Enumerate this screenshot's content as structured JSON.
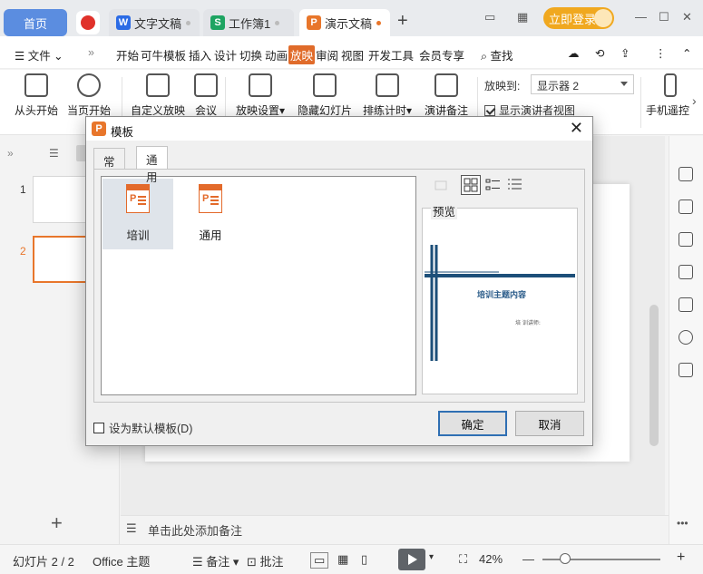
{
  "tabs": {
    "home": "首页",
    "doc": "文字文稿",
    "sheet": "工作簿1",
    "ppt": "演示文稿",
    "login": "立即登录"
  },
  "menu": [
    "开始",
    "可牛模板",
    "插入",
    "设计",
    "切换",
    "动画",
    "放映",
    "审阅",
    "视图",
    "开发工具",
    "会员专享"
  ],
  "menu_active": "放映",
  "file_label": "文件",
  "search_label": "查找",
  "ribbon": {
    "from_start": "从头开始",
    "from_current": "当页开始",
    "custom_show": "自定义放映",
    "meeting": "会议",
    "show_settings": "放映设置",
    "hide_slide": "隐藏幻灯片",
    "rehearse": "排练计时",
    "presenter_notes": "演讲备注",
    "show_on_label": "放映到:",
    "show_on_value": "显示器 2",
    "presenter_view": "显示演讲者视图",
    "phone_remote": "手机遥控"
  },
  "slides": [
    "1",
    "2"
  ],
  "notes_placeholder": "单击此处添加备注",
  "status": {
    "slide_info": "幻灯片 2 / 2",
    "theme": "Office 主题",
    "notes": "备注",
    "comments": "批注",
    "zoom": "42%"
  },
  "dialog": {
    "title": "模板",
    "tabs": [
      "常规",
      "通用"
    ],
    "active_tab": "通用",
    "templates": [
      {
        "label": "培训",
        "selected": true
      },
      {
        "label": "通用",
        "selected": false
      }
    ],
    "preview_label": "预览",
    "preview_title": "培训主题内容",
    "preview_sub": "培 训讲师:",
    "default_checkbox": "设为默认模板(D)",
    "ok": "确定",
    "cancel": "取消"
  },
  "colors": {
    "accent": "#e8762b",
    "home_tab": "#5b8de0",
    "login": "#f0a81f",
    "preview_line": "#1d4f79"
  }
}
